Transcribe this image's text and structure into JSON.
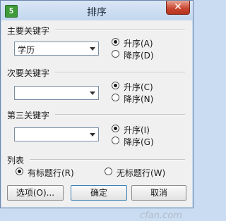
{
  "window": {
    "title": "排序",
    "app_icon_glyph": "5",
    "close_glyph": "✕"
  },
  "primary_key": {
    "label": "主要关键字",
    "selected": "学历",
    "ascending": "升序(A)",
    "descending": "降序(D)"
  },
  "secondary_key": {
    "label": "次要关键字",
    "selected": "",
    "ascending": "升序(C)",
    "descending": "降序(N)"
  },
  "third_key": {
    "label": "第三关键字",
    "selected": "",
    "ascending": "升序(I)",
    "descending": "降序(G)"
  },
  "list": {
    "label": "列表",
    "with_header": "有标题行(R)",
    "without_header": "无标题行(W)"
  },
  "buttons": {
    "options": "选项(O)...",
    "ok": "确定",
    "cancel": "取消"
  },
  "watermark": "cfan.com"
}
